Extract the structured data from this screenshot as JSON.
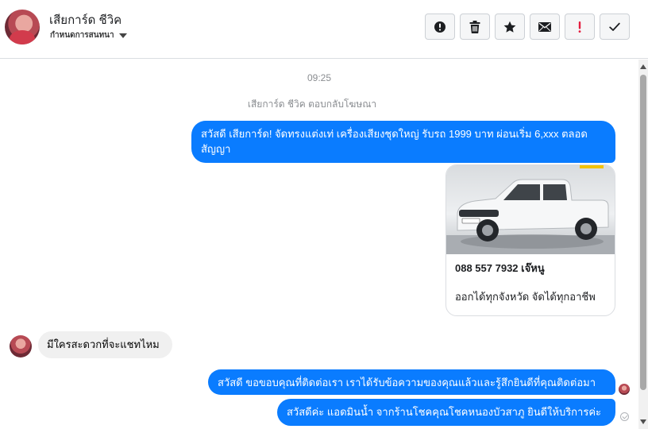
{
  "header": {
    "contact_name": "เสียการ์ด ชีวิค",
    "conversation_settings": "กำหนดการสนทนา",
    "toolbar": [
      {
        "name": "alert-circle-button",
        "icon": "alert-circle-icon"
      },
      {
        "name": "delete-button",
        "icon": "trash-icon"
      },
      {
        "name": "star-button",
        "icon": "star-icon"
      },
      {
        "name": "email-button",
        "icon": "envelope-icon"
      },
      {
        "name": "important-button",
        "icon": "exclamation-icon"
      },
      {
        "name": "done-button",
        "icon": "check-icon"
      }
    ]
  },
  "thread": {
    "timestamp": "09:25",
    "system_note": "เสียการ์ด ชีวิค ตอบกลับโฆษณา",
    "messages": [
      {
        "direction": "out",
        "text": "สวัสดี เสียการ์ด! จัดทรงแต่งเท่ เครื่องเสียงชุดใหญ่ รับรถ 1999 บาท ผ่อนเริ่ม 6,xxx ตลอดสัญญา"
      },
      {
        "direction": "out",
        "type": "card",
        "title": "088 557 7932 เจ๊หนู",
        "description": "ออกได้ทุกจังหวัด จัดได้ทุกอาชีพ"
      },
      {
        "direction": "in",
        "text": "มีใครสะดวกที่จะแชทไหม"
      },
      {
        "direction": "out",
        "text": "สวัสดี ขอขอบคุณที่ติดต่อเรา เราได้รับข้อความของคุณแล้วและรู้สึกยินดีที่คุณติดต่อมา"
      },
      {
        "direction": "out",
        "text": "สวัสดีค่ะ แอดมินน้ำ จากร้านโชคคุณโชคหนองบัวสาภู ยินดีให้บริการค่ะ"
      }
    ]
  },
  "colors": {
    "outgoing_bubble": "#0a7cff",
    "incoming_bubble": "#f0f0f0",
    "important_icon": "#e41e3f"
  }
}
